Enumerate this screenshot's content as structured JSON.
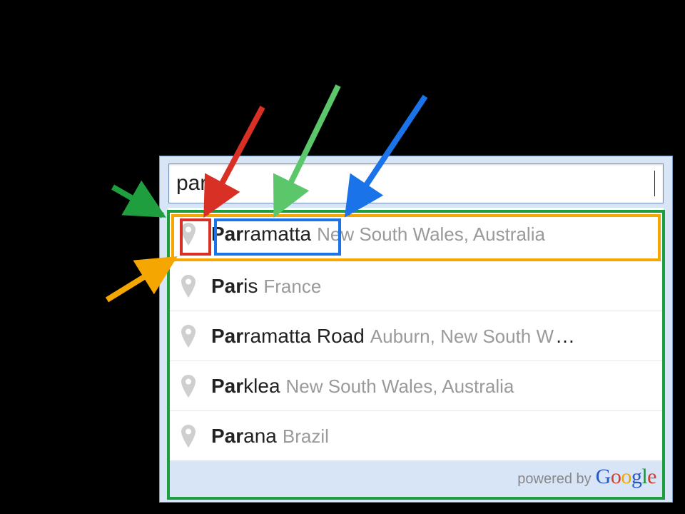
{
  "search": {
    "value": "par"
  },
  "results": [
    {
      "matched": "Par",
      "rest": "ramatta",
      "secondary": "New South Wales, Australia",
      "truncated": false
    },
    {
      "matched": "Par",
      "rest": "is",
      "secondary": "France",
      "truncated": false
    },
    {
      "matched": "Par",
      "rest": "ramatta Road",
      "secondary": "Auburn, New South W",
      "truncated": true
    },
    {
      "matched": "Par",
      "rest": "klea",
      "secondary": "New South Wales, Australia",
      "truncated": false
    },
    {
      "matched": "Par",
      "rest": "ana",
      "secondary": "Brazil",
      "truncated": false
    }
  ],
  "attribution": {
    "prefix": "powered by",
    "logo_letters": [
      "G",
      "o",
      "o",
      "g",
      "l",
      "e"
    ]
  },
  "annotations": {
    "arrow_colors": {
      "green": "#1e9e3e",
      "orange": "#f5a600",
      "red": "#d93025",
      "light_green": "#5cc66b",
      "blue": "#1a73e8"
    }
  }
}
